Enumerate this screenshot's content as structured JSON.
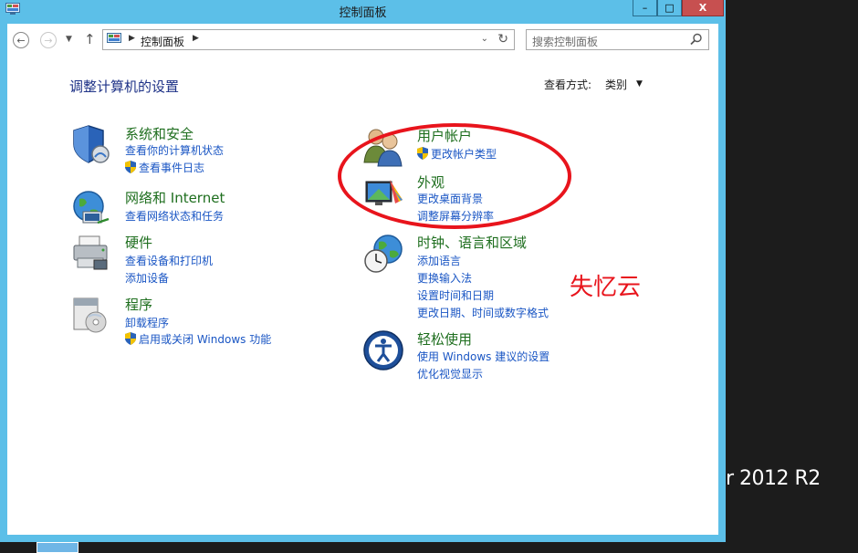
{
  "window": {
    "title": "控制面板",
    "minimize": "–",
    "maximize": "□",
    "close": "X"
  },
  "nav": {
    "address": "控制面板",
    "search_placeholder": "搜索控制面板"
  },
  "main": {
    "heading": "调整计算机的设置",
    "view_by_label": "查看方式:",
    "view_by_value": "类别"
  },
  "categories": [
    {
      "title": "系统和安全",
      "links": [
        "查看你的计算机状态",
        "查看事件日志"
      ],
      "shield_links": [
        false,
        true
      ],
      "icon": "shield-icon"
    },
    {
      "title": "网络和 Internet",
      "links": [
        "查看网络状态和任务"
      ],
      "shield_links": [
        false
      ],
      "icon": "network-globe-icon"
    },
    {
      "title": "硬件",
      "links": [
        "查看设备和打印机",
        "添加设备"
      ],
      "shield_links": [
        false,
        false
      ],
      "icon": "printer-icon"
    },
    {
      "title": "程序",
      "links": [
        "卸载程序",
        "启用或关闭 Windows 功能"
      ],
      "shield_links": [
        false,
        true
      ],
      "icon": "programs-icon"
    },
    {
      "title": "用户帐户",
      "links": [
        "更改帐户类型"
      ],
      "shield_links": [
        true
      ],
      "icon": "users-icon"
    },
    {
      "title": "外观",
      "links": [
        "更改桌面背景",
        "调整屏幕分辨率"
      ],
      "shield_links": [
        false,
        false
      ],
      "icon": "appearance-icon"
    },
    {
      "title": "时钟、语言和区域",
      "links": [
        "添加语言",
        "更换输入法",
        "设置时间和日期",
        "更改日期、时间或数字格式"
      ],
      "shield_links": [
        false,
        false,
        false,
        false
      ],
      "icon": "clock-globe-icon"
    },
    {
      "title": "轻松使用",
      "links": [
        "使用 Windows 建议的设置",
        "优化视觉显示"
      ],
      "shield_links": [
        false,
        false
      ],
      "icon": "ease-of-access-icon"
    }
  ],
  "annotation": {
    "watermark": "失忆云"
  },
  "desktop": {
    "branding": "r 2012 R2"
  },
  "colors": {
    "window_frame": "#5cbfe8",
    "link": "#1a56c4",
    "category_title": "#1e6e1e",
    "heading": "#1e3287",
    "annotation": "#e8141c"
  }
}
